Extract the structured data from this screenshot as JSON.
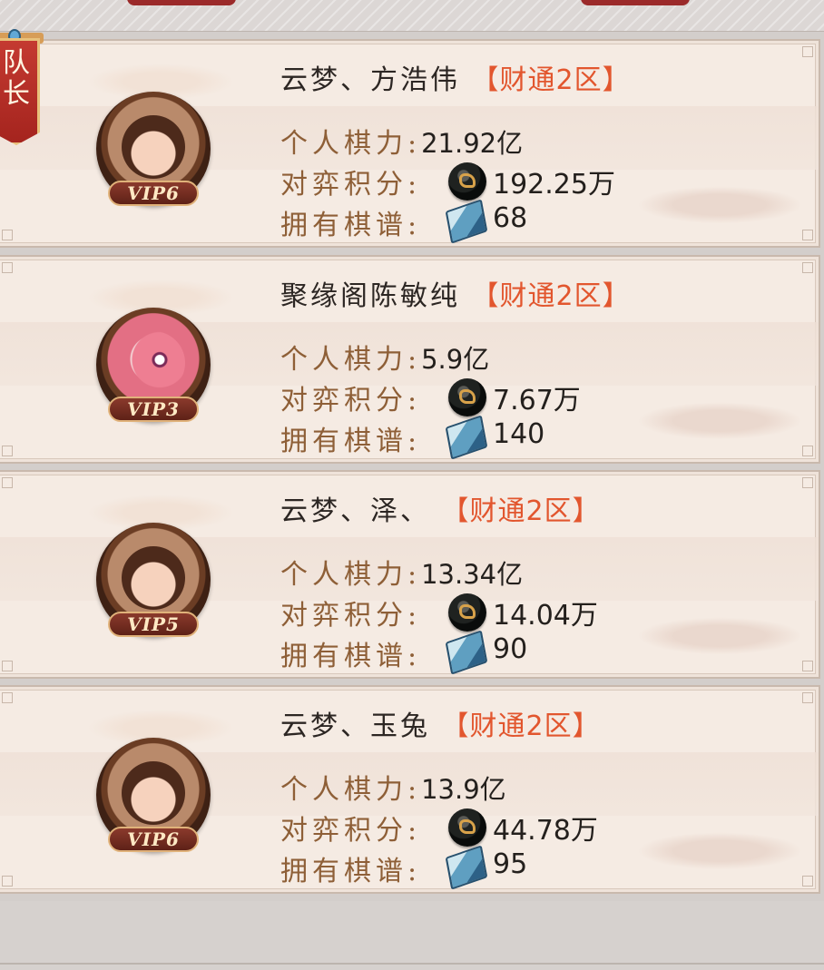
{
  "captain_flag": {
    "label": "队长",
    "visible_text": "队\n长"
  },
  "members": [
    {
      "name": "云梦、方浩伟",
      "server": "【财通2区】",
      "vip": "VIP6",
      "avatar": "warrior-male",
      "stats": {
        "power_label": "个人棋力:",
        "power_value": "21.92亿",
        "score_label": "对弈积分:",
        "score_value": "192.25万",
        "manual_label": "拥有棋谱:",
        "manual_value": "68"
      }
    },
    {
      "name": "聚缘阁陈敏纯",
      "server": "【财通2区】",
      "vip": "VIP3",
      "avatar": "pink-fish",
      "stats": {
        "power_label": "个人棋力:",
        "power_value": "5.9亿",
        "score_label": "对弈积分:",
        "score_value": "7.67万",
        "manual_label": "拥有棋谱:",
        "manual_value": "140"
      }
    },
    {
      "name": "云梦、泽、",
      "server": "【财通2区】",
      "vip": "VIP5",
      "avatar": "lady-red-ornaments",
      "stats": {
        "power_label": "个人棋力:",
        "power_value": "13.34亿",
        "score_label": "对弈积分:",
        "score_value": "14.04万",
        "manual_label": "拥有棋谱:",
        "manual_value": "90"
      }
    },
    {
      "name": "云梦、玉兔",
      "server": "【财通2区】",
      "vip": "VIP6",
      "avatar": "lady-flower-hairpin",
      "stats": {
        "power_label": "个人棋力:",
        "power_value": "13.9亿",
        "score_label": "对弈积分:",
        "score_value": "44.78万",
        "manual_label": "拥有棋谱:",
        "manual_value": "95"
      }
    }
  ],
  "icons": {
    "score": "go-stone-icon",
    "manual": "chess-manual-book-icon"
  },
  "colors": {
    "server_tag": "#e2562e",
    "label_brown": "#8e5f37",
    "value_dark": "#24201d",
    "card_bg": "#f5ebe3",
    "vip_badge": "#6a2a20",
    "captain_red": "#b82d26"
  }
}
